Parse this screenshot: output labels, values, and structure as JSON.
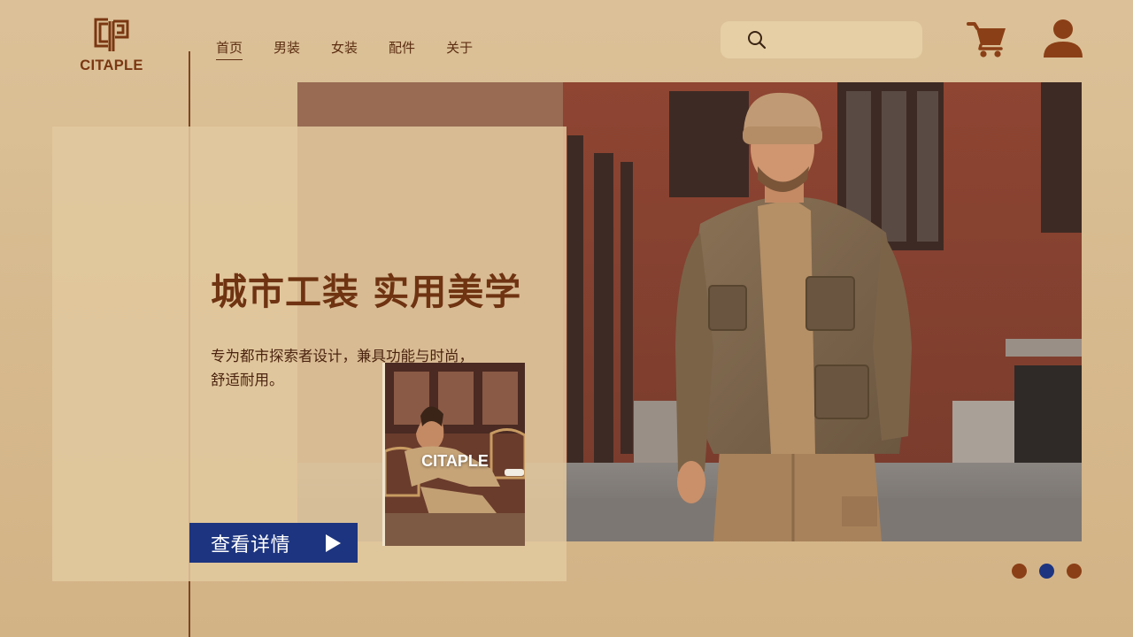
{
  "brand": {
    "name": "CITAPLE"
  },
  "nav": {
    "items": [
      {
        "label": "首页",
        "active": true
      },
      {
        "label": "男装",
        "active": false
      },
      {
        "label": "女装",
        "active": false
      },
      {
        "label": "配件",
        "active": false
      },
      {
        "label": "关于",
        "active": false
      }
    ]
  },
  "search": {
    "value": "",
    "placeholder": ""
  },
  "icons": {
    "search": "search-icon",
    "cart": "cart-icon",
    "user": "user-icon",
    "cta_arrow": "play-arrow-icon"
  },
  "hero": {
    "headline": "城市工装 实用美学",
    "subline1": "专为都市探索者设计，兼具功能与时尚，",
    "subline2": "舒适耐用。",
    "cta_label": "查看详情",
    "thumb_label": "CITAPLE"
  },
  "carousel": {
    "slides": 3,
    "active_index": 1
  },
  "colors": {
    "background": "#d8bc90",
    "brand_brown": "#7a3712",
    "accent_blue": "#1d3580",
    "dot": "#8b3f16"
  }
}
